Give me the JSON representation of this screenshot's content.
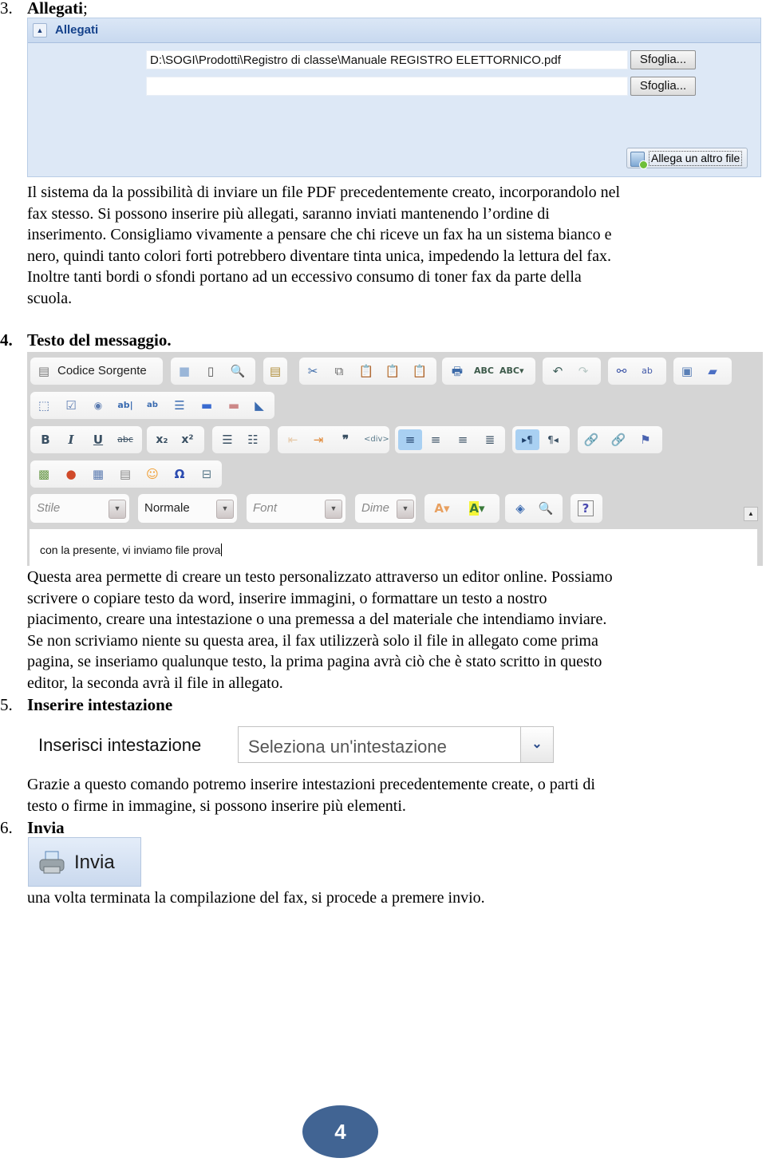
{
  "section3": {
    "number": "3.",
    "title": "Allegati",
    "suffix": ";",
    "panel": {
      "title": "Allegati",
      "file_inputs": [
        {
          "value": "D:\\SOGI\\Prodotti\\Registro di classe\\Manuale REGISTRO ELETTORNICO.pdf",
          "browse_label": "Sfoglia..."
        },
        {
          "value": "",
          "browse_label": "Sfoglia..."
        }
      ],
      "add_file_label": "Allega un altro file"
    },
    "paragraph_lines": [
      "Il sistema da la possibilità di inviare un file PDF precedentemente creato, incorporandolo nel",
      "fax stesso. Si possono inserire più allegati, saranno inviati mantenendo l’ordine di",
      "inserimento. Consigliamo vivamente a pensare che chi riceve un fax ha un sistema bianco e",
      "nero, quindi tanto colori forti potrebbero diventare tinta unica, impedendo la lettura del fax.",
      "Inoltre tanti bordi o sfondi portano ad un eccessivo consumo di toner fax da parte della",
      "scuola."
    ]
  },
  "section4": {
    "number": "4.",
    "title": "Testo del messaggio.",
    "editor": {
      "source_button_label": "Codice Sorgente",
      "combos": {
        "style": "Stile",
        "format": "Normale",
        "font": "Font",
        "size": "Dime"
      },
      "content": "con la presente, vi inviamo file prova"
    },
    "paragraph_lines": [
      "Questa area permette di creare un testo personalizzato attraverso un editor online. Possiamo",
      "scrivere o copiare testo da word, inserire immagini, o formattare un testo a nostro",
      "piacimento, creare una intestazione o una premessa a del materiale che intendiamo inviare.",
      "Se non scriviamo niente su questa area, il fax utilizzerà solo il file in allegato come prima",
      "pagina, se inseriamo qualunque testo, la prima pagina avrà ciò che è stato scritto in questo",
      "editor, la seconda avrà il file in allegato."
    ]
  },
  "section5": {
    "number": "5.",
    "title": "Inserire intestazione",
    "label": "Inserisci intestazione",
    "select_value": "Seleziona un'intestazione",
    "paragraph_lines": [
      "Grazie a questo comando potremo inserire intestazioni precedentemente create, o parti di",
      "testo o firme in immagine, si possono inserire più elementi."
    ]
  },
  "section6": {
    "number": "6.",
    "title": "Invia",
    "button_label": "Invia",
    "paragraph": "una volta terminata la compilazione del fax, si procede a premere invio."
  },
  "page_number": "4"
}
